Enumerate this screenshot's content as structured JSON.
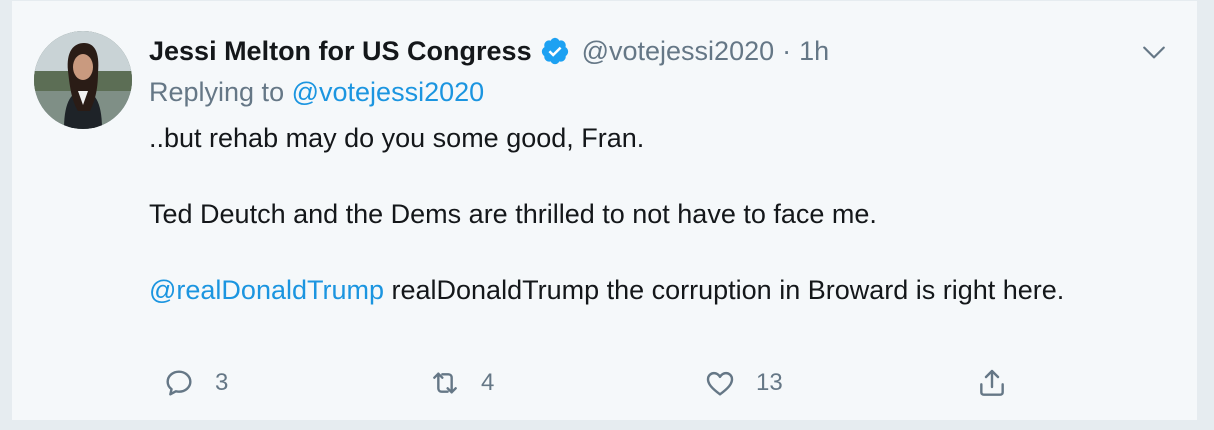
{
  "tweet": {
    "author_name": "Jessi Melton for US Congress",
    "verified": true,
    "handle": "@votejessi2020",
    "separator": "·",
    "time": "1h",
    "replying_prefix": "Replying to",
    "replying_handle": "@votejessi2020",
    "body": {
      "line1": "..but rehab may do you some good, Fran.",
      "line2": "Ted Deutch and the Dems are thrilled to not have to face me.",
      "mention": "@realDonaldTrump",
      "line3_rest": " realDonaldTrump the corruption in Broward is right here."
    },
    "actions": {
      "reply_count": "3",
      "retweet_count": "4",
      "like_count": "13"
    }
  },
  "icons": {
    "verified": "verified-badge-icon",
    "menu": "chevron-down-icon",
    "reply": "reply-icon",
    "retweet": "retweet-icon",
    "like": "heart-icon",
    "share": "share-icon"
  },
  "colors": {
    "link": "#1b95e0",
    "muted": "#657786",
    "text": "#14171a",
    "card_bg": "#f5f8fa",
    "page_bg": "#e6ecf0"
  }
}
